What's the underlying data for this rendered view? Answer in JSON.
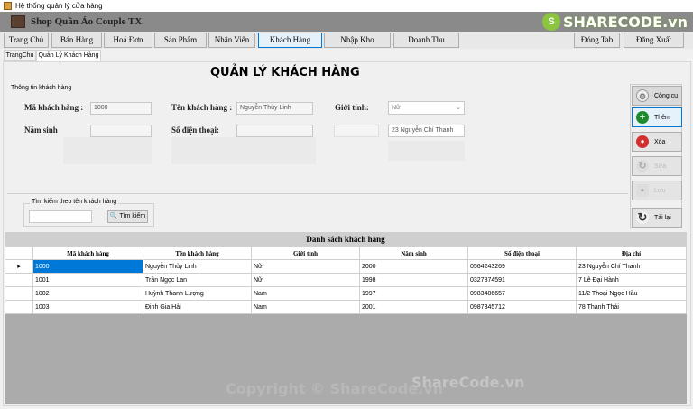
{
  "window": {
    "title": "Hệ thống quản lý cửa hàng"
  },
  "header": {
    "shop_name": "Shop Quần Áo Couple TX",
    "watermark_logo": "SHARECODE.vn"
  },
  "menu": {
    "items": [
      "Trang Chủ",
      "Bán Hàng",
      "Hoá Đơn",
      "Sản Phẩm",
      "Nhân Viên",
      "Khách Hàng",
      "Nhập Kho",
      "Doanh Thu"
    ],
    "close_tab": "Đóng Tab",
    "logout": "Đăng Xuất"
  },
  "tabs": [
    "TrangChu",
    "Quản Lý Khách Hàng"
  ],
  "page_title": "QUẢN LÝ KHÁCH HÀNG",
  "info_group": {
    "legend": "Thông tin khách hàng",
    "id_label": "Mã khách hàng :",
    "id_value": "1000",
    "name_label": "Tên khách hàng :",
    "name_value": "Nguyễn Thủy Linh",
    "gender_label": "Giới tính:",
    "gender_value": "Nữ",
    "birth_label": "Năm sinh",
    "phone_label": "Số điện thoại:",
    "address_value": "23 Nguyễn Chí Thanh"
  },
  "search": {
    "legend": "Tìm kiếm theo tên khách hàng",
    "input_value": "",
    "button": "Tìm kiếm"
  },
  "tools": {
    "header": "Công cụ",
    "add": "Thêm",
    "delete": "Xóa",
    "edit": "Sửa",
    "save": "Lưu",
    "reload": "Tải lại"
  },
  "grid": {
    "title": "Danh sách  khách hàng",
    "columns": [
      "Mã khách hàng",
      "Tên khách hàng",
      "Giới tính",
      "Năm sinh",
      "Số điện thoại",
      "Địa chỉ"
    ],
    "rows": [
      [
        "1000",
        "Nguyễn Thủy Linh",
        "Nữ",
        "2000",
        "0564243269",
        "23 Nguyễn Chí Thanh"
      ],
      [
        "1001",
        "Trần Ngọc Lan",
        "Nữ",
        "1998",
        "0327874591",
        "7 Lê Đại Hành"
      ],
      [
        "1002",
        "Huỳnh Thanh Lượng",
        "Nam",
        "1997",
        "0983486657",
        "11/2 Thoại Ngọc Hầu"
      ],
      [
        "1003",
        "Đinh Gia Hải",
        "Nam",
        "2001",
        "0987345712",
        "78 Thành Thái"
      ]
    ]
  },
  "watermarks": {
    "copyright": "Copyright © ShareCode.vn",
    "sharecode": "ShareCode.vn"
  }
}
